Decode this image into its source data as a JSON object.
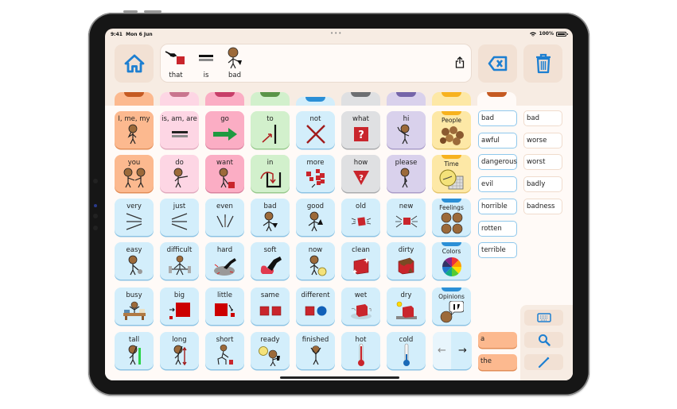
{
  "status_bar": {
    "time": "9:41",
    "date": "Mon 6 Jun",
    "center_dots": "•••",
    "battery": "100%"
  },
  "toolbar": {
    "home_icon": "house-icon",
    "share_icon": "share-icon",
    "backspace_icon": "backspace-icon",
    "clear_icon": "trash-icon"
  },
  "message": {
    "words": [
      {
        "label": "that",
        "symbol": "pointing-hand-red-square"
      },
      {
        "label": "is",
        "symbol": "equals-sign"
      },
      {
        "label": "bad",
        "symbol": "person-thumbs-down"
      }
    ]
  },
  "tabs": [
    {
      "color": "#fcb98f",
      "notch": "#c55a22"
    },
    {
      "color": "#fdd6e4",
      "notch": "#c9758e"
    },
    {
      "color": "#fbadc4",
      "notch": "#c73e68"
    },
    {
      "color": "#d2f0cc",
      "notch": "#5a9448"
    },
    {
      "color": "#d3eefb",
      "notch": "#2b8fd6"
    },
    {
      "color": "#dfe0e2",
      "notch": "#6d6f72"
    },
    {
      "color": "#d9d1ec",
      "notch": "#7565a9"
    },
    {
      "color": "#fde8a6",
      "notch": "#f7b21f"
    },
    {
      "color": "#fffaf7",
      "notch": "#c55a22"
    }
  ],
  "grid": [
    [
      {
        "label": "I, me, my",
        "color": "orange",
        "symbol": "person-self"
      },
      {
        "label": "is, am, are",
        "color": "lpink",
        "symbol": "equals"
      },
      {
        "label": "go",
        "color": "pink",
        "symbol": "green-arrow"
      },
      {
        "label": "to",
        "color": "green",
        "symbol": "arrow-to-line"
      },
      {
        "label": "not",
        "color": "blue",
        "symbol": "red-x"
      },
      {
        "label": "what",
        "color": "grey",
        "symbol": "question-square"
      },
      {
        "label": "hi",
        "color": "purple",
        "symbol": "person-waving"
      },
      {
        "label": "People",
        "color": "yellow",
        "symbol": "people-group",
        "category": true
      }
    ],
    [
      {
        "label": "you",
        "color": "orange",
        "symbol": "two-people"
      },
      {
        "label": "do",
        "color": "lpink",
        "symbol": "person-doing"
      },
      {
        "label": "want",
        "color": "pink",
        "symbol": "person-want"
      },
      {
        "label": "in",
        "color": "green",
        "symbol": "arrow-into-box"
      },
      {
        "label": "more",
        "color": "blue",
        "symbol": "many-squares"
      },
      {
        "label": "how",
        "color": "grey",
        "symbol": "question-triangle"
      },
      {
        "label": "please",
        "color": "purple",
        "symbol": "person-please"
      },
      {
        "label": "Time",
        "color": "yellow",
        "symbol": "clock-calendar",
        "category": true
      }
    ],
    [
      {
        "label": "very",
        "color": "blue",
        "symbol": "lines-very"
      },
      {
        "label": "just",
        "color": "blue",
        "symbol": "lines-just"
      },
      {
        "label": "even",
        "color": "blue",
        "symbol": "lines-even"
      },
      {
        "label": "bad",
        "color": "blue",
        "symbol": "person-thumbs-down"
      },
      {
        "label": "good",
        "color": "blue",
        "symbol": "person-thumbs-up"
      },
      {
        "label": "old",
        "color": "blue",
        "symbol": "old-square"
      },
      {
        "label": "new",
        "color": "blue",
        "symbol": "new-square"
      },
      {
        "label": "Feelings",
        "color": "blue",
        "symbol": "four-faces",
        "category": true
      }
    ],
    [
      {
        "label": "easy",
        "color": "blue",
        "symbol": "person-lifting-light"
      },
      {
        "label": "difficult",
        "color": "blue",
        "symbol": "person-lifting-heavy"
      },
      {
        "label": "hard",
        "color": "blue",
        "symbol": "hand-on-rock"
      },
      {
        "label": "soft",
        "color": "blue",
        "symbol": "hand-on-cushion"
      },
      {
        "label": "now",
        "color": "blue",
        "symbol": "person-clock"
      },
      {
        "label": "clean",
        "color": "blue",
        "symbol": "shiny-cube"
      },
      {
        "label": "dirty",
        "color": "blue",
        "symbol": "dirty-cube"
      },
      {
        "label": "Colors",
        "color": "blue",
        "symbol": "color-wheel",
        "category": true
      }
    ],
    [
      {
        "label": "busy",
        "color": "blue",
        "symbol": "person-at-desk"
      },
      {
        "label": "big",
        "color": "blue",
        "symbol": "big-square"
      },
      {
        "label": "little",
        "color": "blue",
        "symbol": "little-square"
      },
      {
        "label": "same",
        "color": "blue",
        "symbol": "two-squares"
      },
      {
        "label": "different",
        "color": "blue",
        "symbol": "square-circle"
      },
      {
        "label": "wet",
        "color": "blue",
        "symbol": "wet-cube"
      },
      {
        "label": "dry",
        "color": "blue",
        "symbol": "dry-cube-sun"
      },
      {
        "label": "Opinions",
        "color": "blue",
        "symbol": "face-speech",
        "category": true
      }
    ],
    [
      {
        "label": "tall",
        "color": "blue",
        "symbol": "person-tall"
      },
      {
        "label": "long",
        "color": "blue",
        "symbol": "person-long"
      },
      {
        "label": "short",
        "color": "blue",
        "symbol": "person-short"
      },
      {
        "label": "ready",
        "color": "blue",
        "symbol": "person-ready"
      },
      {
        "label": "finished",
        "color": "blue",
        "symbol": "person-finished"
      },
      {
        "label": "hot",
        "color": "blue",
        "symbol": "thermometer-hot"
      },
      {
        "label": "cold",
        "color": "blue",
        "symbol": "thermometer-cold"
      }
    ]
  ],
  "nav": {
    "prev": "←",
    "next": "→"
  },
  "synonyms": [
    "bad",
    "awful",
    "dangerous",
    "evil",
    "horrible",
    "rotten",
    "terrible"
  ],
  "word_forms": [
    "bad",
    "worse",
    "worst",
    "badly",
    "badness"
  ],
  "articles": [
    "a",
    "the"
  ],
  "tools": [
    {
      "icon": "keyboard-icon"
    },
    {
      "icon": "search-icon"
    },
    {
      "icon": "pencil-icon"
    }
  ]
}
